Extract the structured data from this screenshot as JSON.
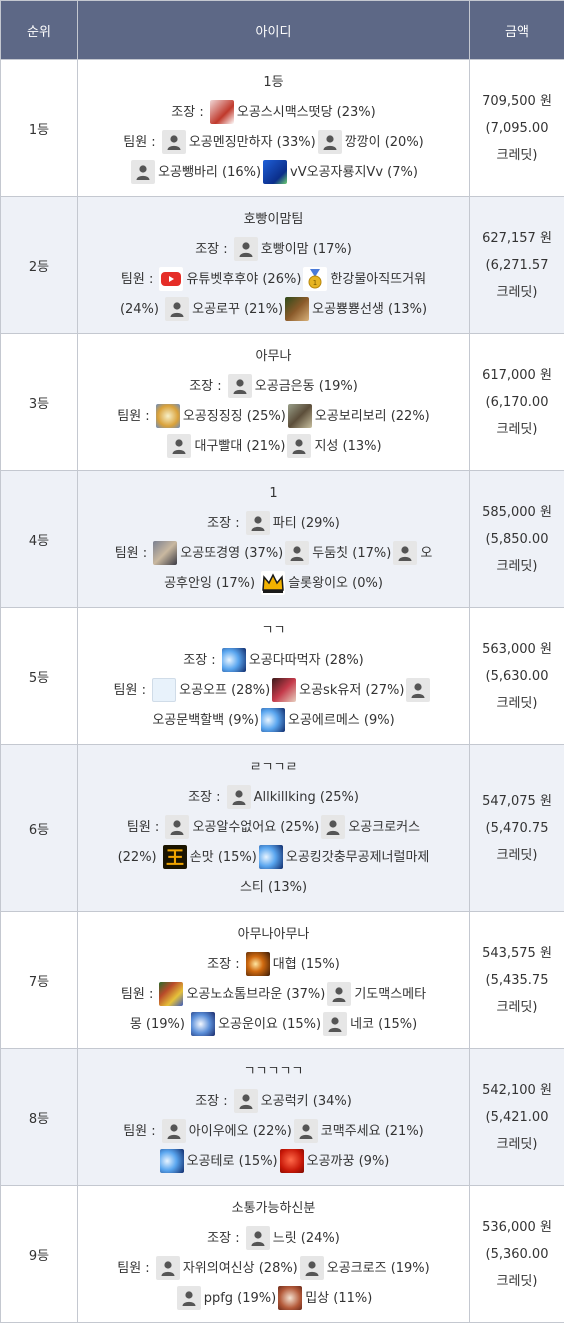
{
  "header": {
    "rank": "순위",
    "id": "아이디",
    "amount": "금액"
  },
  "rows": [
    {
      "rank": "1등",
      "team": "1등",
      "lines": [
        [
          {
            "t": "조장 : "
          },
          {
            "a": "img1",
            "icon": "clock-character-icon"
          },
          {
            "t": "오공스시맥스떳당 (23%)"
          }
        ],
        [
          {
            "t": "팀원 : "
          },
          {
            "a": "user"
          },
          {
            "t": "오공멘징만하자 (33%)"
          },
          {
            "a": "user"
          },
          {
            "t": "깡깡이 (20%)"
          }
        ],
        [
          {
            "a": "user"
          },
          {
            "t": "오공뺑바리 (16%)"
          },
          {
            "a": "img2",
            "icon": "blue-pouch-icon"
          },
          {
            "t": "vV오공자룡지Vv (7%)"
          }
        ]
      ],
      "amount": "709,500 원",
      "credit1": "(7,095.00",
      "credit2": "크레딧)"
    },
    {
      "rank": "2등",
      "team": "호빵이맘팀",
      "lines": [
        [
          {
            "t": "조장 : "
          },
          {
            "a": "user"
          },
          {
            "t": "호빵이맘 (17%)"
          }
        ],
        [
          {
            "t": "팀원 : "
          },
          {
            "a": "img3",
            "icon": "youtube-play-icon"
          },
          {
            "t": "유튜벳후후야 (26%)"
          },
          {
            "a": "img4",
            "icon": "medal-icon"
          },
          {
            "t": "한강물아직뜨거워"
          }
        ],
        [
          {
            "t": "(24%) "
          },
          {
            "a": "user"
          },
          {
            "t": "오공로꾸 (21%)"
          },
          {
            "a": "img5",
            "icon": "goblin-icon"
          },
          {
            "t": "오공뿅뿅선생 (13%)"
          }
        ]
      ],
      "amount": "627,157 원",
      "credit1": "(6,271.57",
      "credit2": "크레딧)"
    },
    {
      "rank": "3등",
      "team": "아무나",
      "lines": [
        [
          {
            "t": "조장 : "
          },
          {
            "a": "user"
          },
          {
            "t": "오공금은동 (19%)"
          }
        ],
        [
          {
            "t": "팀원 : "
          },
          {
            "a": "img6",
            "icon": "compass-icon"
          },
          {
            "t": "오공징징징 (25%)"
          },
          {
            "a": "img7",
            "icon": "landscape-icon"
          },
          {
            "t": "오공보리보리 (22%)"
          }
        ],
        [
          {
            "a": "user"
          },
          {
            "t": "대구빨대 (21%)"
          },
          {
            "a": "user"
          },
          {
            "t": "지성 (13%)"
          }
        ]
      ],
      "amount": "617,000 원",
      "credit1": "(6,170.00",
      "credit2": "크레딧)"
    },
    {
      "rank": "4등",
      "team": "1",
      "lines": [
        [
          {
            "t": "조장 : "
          },
          {
            "a": "user"
          },
          {
            "t": "파티 (29%)"
          }
        ],
        [
          {
            "t": "팀원 : "
          },
          {
            "a": "img8",
            "icon": "photo-icon"
          },
          {
            "t": "오공또경영 (37%)"
          },
          {
            "a": "user"
          },
          {
            "t": "두둠칫 (17%)"
          },
          {
            "a": "user"
          },
          {
            "t": "오"
          }
        ],
        [
          {
            "t": "공후안잉 (17%) "
          },
          {
            "a": "img9",
            "icon": "crown-icon"
          },
          {
            "t": "슬롯왕이오 (0%)"
          }
        ]
      ],
      "amount": "585,000 원",
      "credit1": "(5,850.00",
      "credit2": "크레딧)"
    },
    {
      "rank": "5등",
      "team": "ㄱㄱ",
      "lines": [
        [
          {
            "t": "조장 : "
          },
          {
            "a": "img10",
            "icon": "blue-glow-icon"
          },
          {
            "t": "오공다따먹자 (28%)"
          }
        ],
        [
          {
            "t": "팀원 : "
          },
          {
            "a": "img11",
            "icon": "blank-avatar-icon"
          },
          {
            "t": "오공오프 (28%)"
          },
          {
            "a": "img12",
            "icon": "anime-avatar-icon"
          },
          {
            "t": "오공sk유저 (27%)"
          },
          {
            "a": "user"
          }
        ],
        [
          {
            "t": "오공문백할백 (9%)"
          },
          {
            "a": "img10",
            "icon": "blue-glow-icon"
          },
          {
            "t": "오공에르메스 (9%)"
          }
        ]
      ],
      "amount": "563,000 원",
      "credit1": "(5,630.00",
      "credit2": "크레딧)"
    },
    {
      "rank": "6등",
      "team": "ㄹㄱㄱㄹ",
      "lines": [
        [
          {
            "t": "조장 : "
          },
          {
            "a": "user"
          },
          {
            "t": "Allkillking (25%)"
          }
        ],
        [
          {
            "t": "팀원 : "
          },
          {
            "a": "user"
          },
          {
            "t": "오공알수없어요 (25%)"
          },
          {
            "a": "user"
          },
          {
            "t": "오공크로커스"
          }
        ],
        [
          {
            "t": "(22%) "
          },
          {
            "a": "img13",
            "icon": "king-glyph-icon"
          },
          {
            "t": "손맛 (15%)"
          },
          {
            "a": "img10",
            "icon": "blue-glow-icon"
          },
          {
            "t": "오공킹갓충무공제너럴마제"
          }
        ],
        [
          {
            "t": "스티 (13%)"
          }
        ]
      ],
      "amount": "547,075 원",
      "credit1": "(5,470.75",
      "credit2": "크레딧)"
    },
    {
      "rank": "7등",
      "team": "아무나아무나",
      "lines": [
        [
          {
            "t": "조장 : "
          },
          {
            "a": "img14",
            "icon": "fire-icon"
          },
          {
            "t": "대협 (15%)"
          }
        ],
        [
          {
            "t": "팀원 : "
          },
          {
            "a": "img15",
            "icon": "pixel-grid-icon"
          },
          {
            "t": "오공노쇼톰브라운 (37%)"
          },
          {
            "a": "user"
          },
          {
            "t": "기도맥스메타"
          }
        ],
        [
          {
            "t": "몽 (19%) "
          },
          {
            "a": "img16",
            "icon": "blue-glow-icon"
          },
          {
            "t": "오공운이요 (15%)"
          },
          {
            "a": "user"
          },
          {
            "t": "네코 (15%)"
          }
        ]
      ],
      "amount": "543,575 원",
      "credit1": "(5,435.75",
      "credit2": "크레딧)"
    },
    {
      "rank": "8등",
      "team": "ㄱㄱㄱㄱㄱ",
      "lines": [
        [
          {
            "t": "조장 : "
          },
          {
            "a": "user"
          },
          {
            "t": "오공럭키 (34%)"
          }
        ],
        [
          {
            "t": "팀원 : "
          },
          {
            "a": "user"
          },
          {
            "t": "아이우에오 (22%)"
          },
          {
            "a": "user"
          },
          {
            "t": "코맥주세요 (21%)"
          }
        ],
        [
          {
            "a": "img10",
            "icon": "blue-glow-icon"
          },
          {
            "t": "오공테로 (15%)"
          },
          {
            "a": "img17",
            "icon": "red-ball-icon"
          },
          {
            "t": "오공까꿍 (9%)"
          }
        ]
      ],
      "amount": "542,100 원",
      "credit1": "(5,421.00",
      "credit2": "크레딧)"
    },
    {
      "rank": "9등",
      "team": "소통가능하신분",
      "lines": [
        [
          {
            "t": "조장 : "
          },
          {
            "a": "user"
          },
          {
            "t": "느릿 (24%)"
          }
        ],
        [
          {
            "t": "팀원 : "
          },
          {
            "a": "user"
          },
          {
            "t": "자위의여신상 (28%)"
          },
          {
            "a": "user"
          },
          {
            "t": "오공크로즈 (19%)"
          }
        ],
        [
          {
            "a": "user"
          },
          {
            "t": "ppfg (19%)"
          },
          {
            "a": "img18",
            "icon": "cartoon-face-icon"
          },
          {
            "t": "밉상 (11%)"
          }
        ]
      ],
      "amount": "536,000 원",
      "credit1": "(5,360.00",
      "credit2": "크레딧)"
    }
  ]
}
